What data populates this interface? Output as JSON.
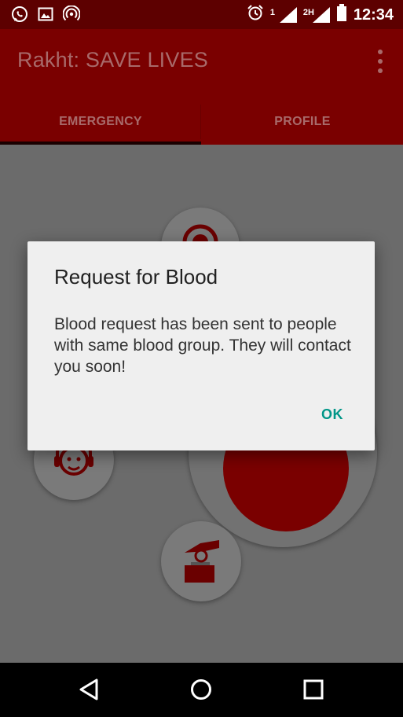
{
  "status_bar": {
    "time": "12:34",
    "sim1_label": "1",
    "sim2_label": "2H",
    "icons": [
      "whatsapp-icon",
      "image-icon",
      "hotspot-icon",
      "alarm-icon",
      "signal-icon",
      "signal-icon",
      "battery-icon"
    ]
  },
  "app_bar": {
    "title": "Rakht: SAVE LIVES",
    "overflow_icon": "more-vert-icon"
  },
  "tabs": [
    {
      "label": "EMERGENCY",
      "selected": true
    },
    {
      "label": "PROFILE",
      "selected": false
    }
  ],
  "background_icons": [
    "blood-drop-icon",
    "support-agent-icon",
    "donate-icon"
  ],
  "dialog": {
    "title": "Request for Blood",
    "message": "Blood request has been sent to people with same blood group. They will contact you soon!",
    "ok_label": "OK"
  },
  "nav_bar": {
    "icons": [
      "back-icon",
      "home-icon",
      "recents-icon"
    ]
  },
  "colors": {
    "primary_dark": "#5d0000",
    "primary": "#7a0000",
    "scrim": "#6b6b6b",
    "dialog_bg": "#efefef",
    "accent": "#009688"
  }
}
